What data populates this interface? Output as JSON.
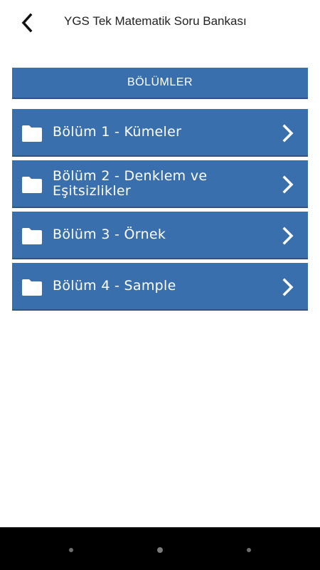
{
  "header": {
    "title": "YGS Tek Matematik Soru Bankası",
    "back_icon": "chevron-left-icon"
  },
  "section": {
    "title": "BÖLÜMLER"
  },
  "chapters": [
    {
      "label": "Bölüm 1 - Kümeler",
      "icon": "folder-icon"
    },
    {
      "label": "Bölüm 2 - Denklem ve Eşitsizlikler",
      "icon": "folder-icon"
    },
    {
      "label": "Bölüm 3 - Örnek",
      "icon": "folder-icon"
    },
    {
      "label": "Bölüm 4 - Sample",
      "icon": "folder-icon"
    }
  ],
  "colors": {
    "accent": "#3a6fad",
    "accent_dark": "#2c5586",
    "background": "#ffffff",
    "nav_bar": "#000000"
  }
}
